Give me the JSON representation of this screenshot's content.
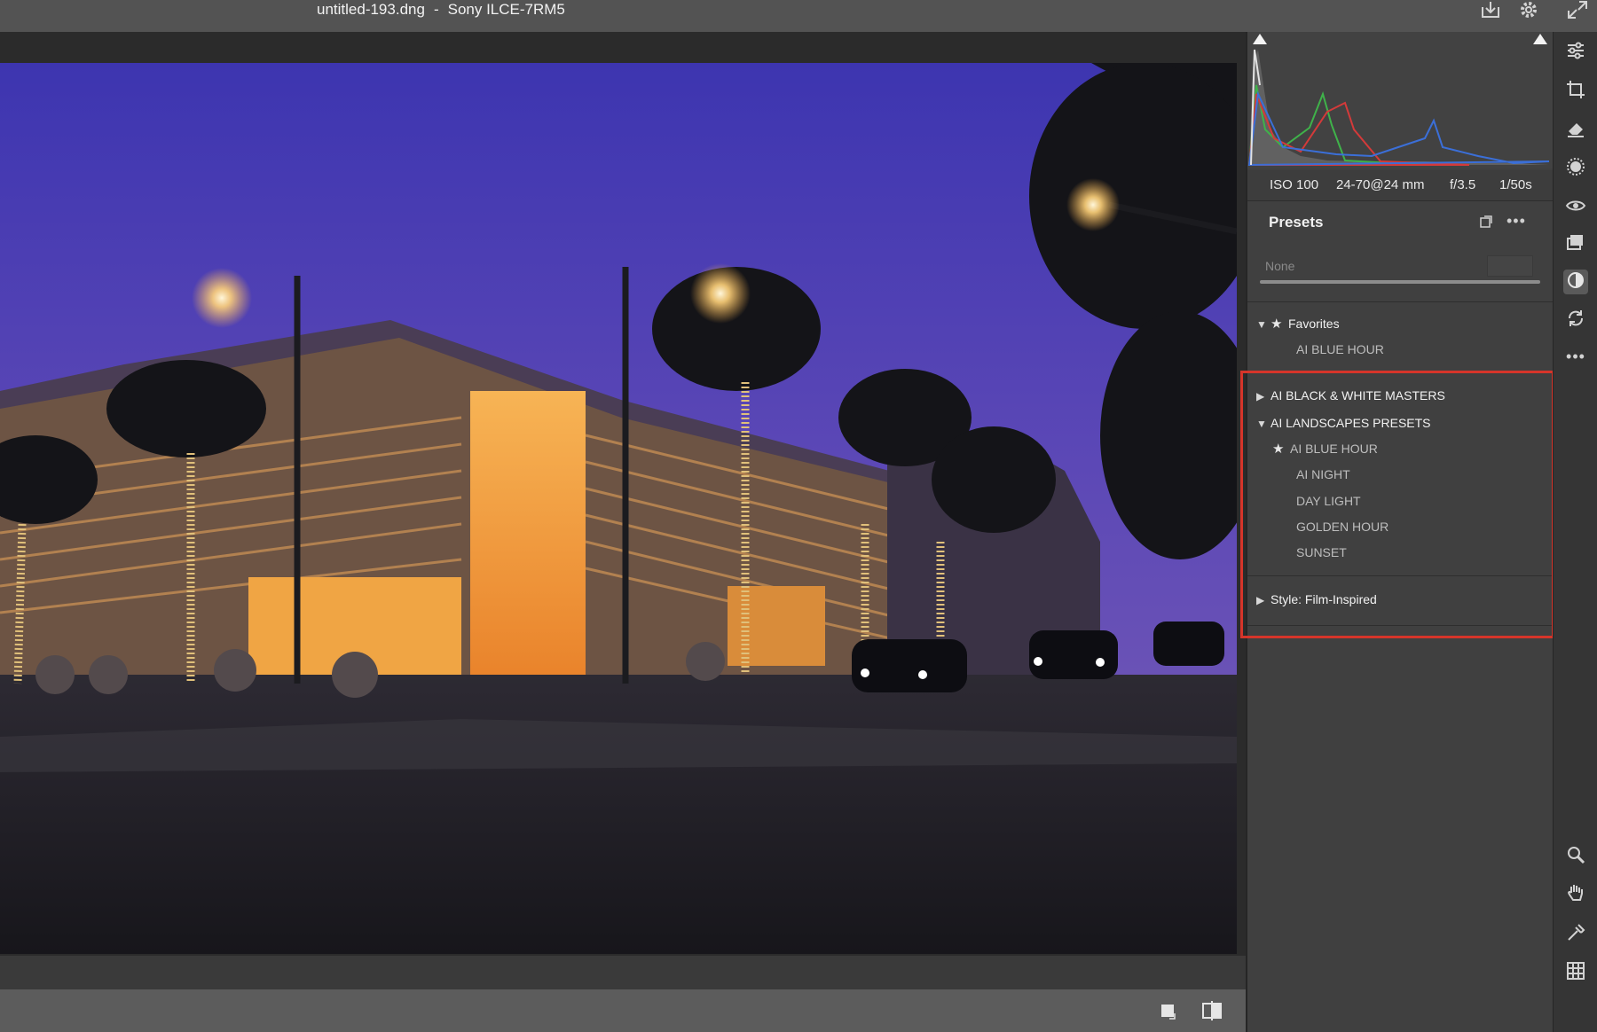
{
  "window": {
    "filename": "untitled-193.dng",
    "separator": "-",
    "camera": "Sony ILCE-7RM5"
  },
  "top_icons": [
    "save-icon",
    "gear-icon",
    "expand-icon"
  ],
  "exif": {
    "iso": "ISO 100",
    "lens": "24-70@24 mm",
    "aperture": "f/3.5",
    "shutter": "1/50s"
  },
  "presets": {
    "title": "Presets",
    "amount_label": "None",
    "favorites": {
      "label": "Favorites",
      "items": [
        {
          "label": "AI BLUE HOUR"
        }
      ]
    },
    "groups": [
      {
        "label": "AI BLACK & WHITE MASTERS",
        "expanded": false
      },
      {
        "label": "AI LANDSCAPES PRESETS",
        "expanded": true,
        "items": [
          {
            "label": "AI BLUE HOUR",
            "favorite": true
          },
          {
            "label": "AI NIGHT",
            "favorite": false
          },
          {
            "label": "DAY LIGHT",
            "favorite": false
          },
          {
            "label": "GOLDEN HOUR",
            "favorite": false
          },
          {
            "label": "SUNSET",
            "favorite": false
          }
        ]
      },
      {
        "label": "Style: Film-Inspired",
        "expanded": false
      }
    ]
  },
  "tool_rail": [
    "edit-sliders-icon",
    "crop-icon",
    "eraser-icon",
    "masking-icon",
    "red-eye-icon",
    "layers-icon",
    "presets-icon",
    "snapshots-icon",
    "more-icon",
    "zoom-icon",
    "hand-icon",
    "sampler-icon",
    "grid-icon"
  ],
  "view_controls": [
    "single-view-icon",
    "before-after-icon"
  ],
  "colors": {
    "highlight_border": "#d6352a",
    "sky_top": "#3d35b0",
    "sky_bottom": "#7c5fb6",
    "warm_light": "#ffb54a"
  }
}
